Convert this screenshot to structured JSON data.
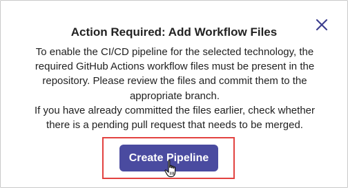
{
  "dialog": {
    "title": "Action Required: Add Workflow Files",
    "message_1": "To enable the CI/CD pipeline for the selected technology, the required GitHub Actions workflow files must be present in the repository. Please review the files and commit them to the appropriate branch.",
    "message_2": "If you have already committed the files earlier, check whether there is a pending pull request that needs to be merged.",
    "primary_button_label": "Create Pipeline",
    "close_icon": "close-icon"
  },
  "colors": {
    "button_bg": "#4a4ba0",
    "close_icon": "#3d3f8f",
    "highlight_border": "#e2413f"
  }
}
